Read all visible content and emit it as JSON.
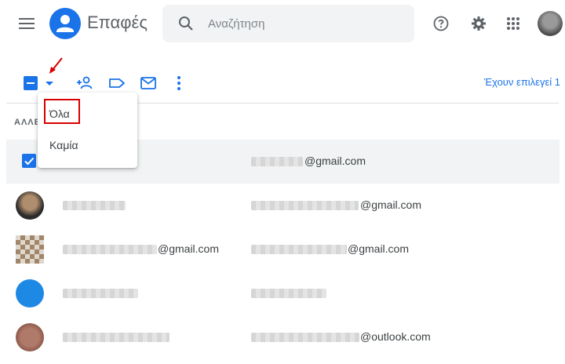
{
  "header": {
    "app_title": "Επαφές",
    "search_placeholder": "Αναζήτηση"
  },
  "toolbar": {
    "selected_count_text": "Έχουν επιλεγεί 1"
  },
  "section_label": "ΑΛΛΕ",
  "dropdown": {
    "items": [
      "Όλα",
      "Καμία"
    ]
  },
  "contacts": [
    {
      "email_suffix": "@gmail.com",
      "selected": true
    },
    {
      "email_suffix": "@gmail.com",
      "selected": false
    },
    {
      "name_suffix": "@gmail.com",
      "email_suffix": "@gmail.com",
      "selected": false
    },
    {
      "selected": false
    },
    {
      "email_suffix": "@outlook.com",
      "selected": false
    }
  ],
  "colors": {
    "accent": "#1a73e8",
    "annotation_red": "#d90000",
    "selected_row": "#f1f3f4"
  }
}
